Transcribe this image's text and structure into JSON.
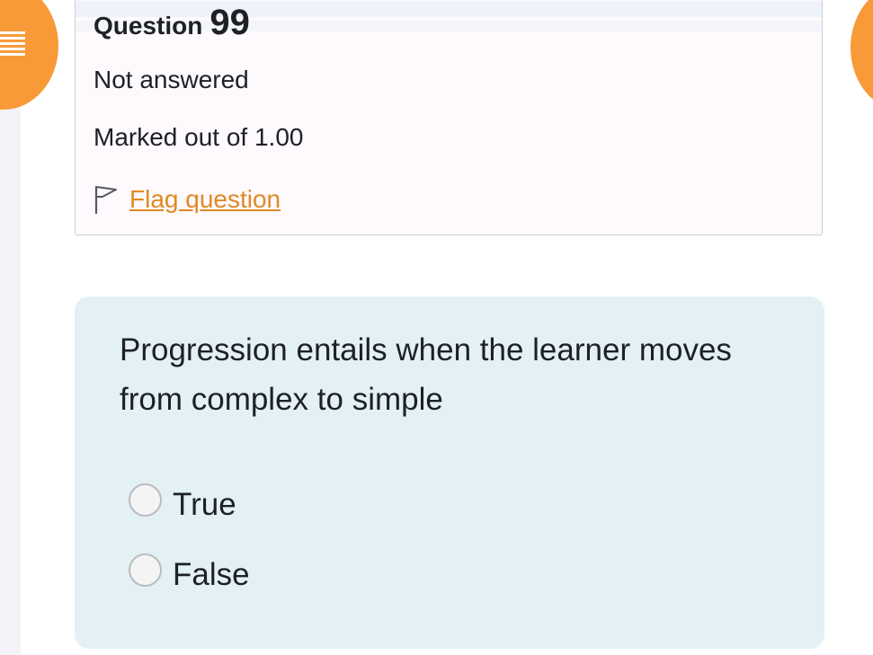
{
  "question_info": {
    "label": "Question",
    "number": "99",
    "status": "Not answered",
    "marks": "Marked out of 1.00",
    "flag_label": "Flag question"
  },
  "question": {
    "text": "Progression entails when the learner moves from complex to simple",
    "options": [
      {
        "label": "True",
        "selected": false
      },
      {
        "label": "False",
        "selected": false
      }
    ]
  },
  "icons": {
    "drawer_toggle": "menu-icon",
    "flag": "flag-outline-icon"
  },
  "colors": {
    "accent_orange": "#f89a38",
    "link_orange": "#e08a23",
    "question_bg": "#e3f1f5",
    "info_bg": "#fdf9fd"
  }
}
